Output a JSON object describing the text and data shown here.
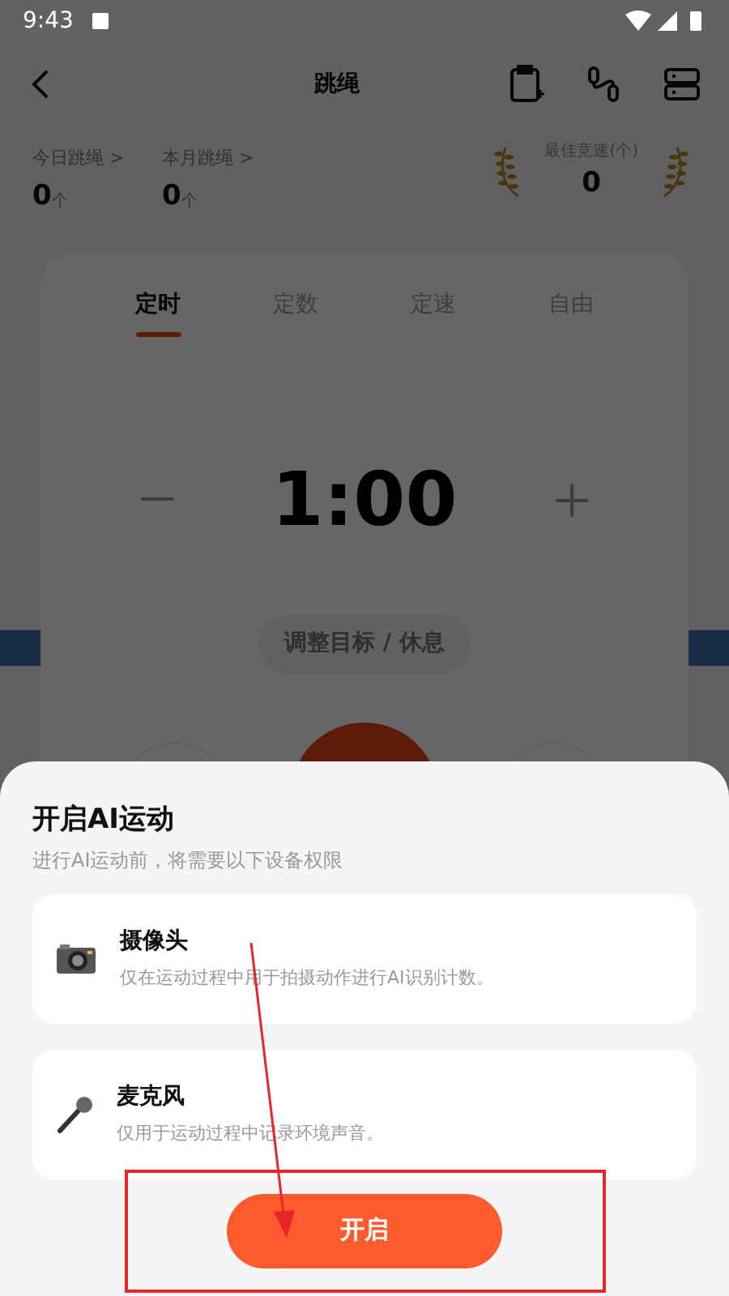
{
  "status_bar": {
    "time": "9:43"
  },
  "header": {
    "title": "跳绳"
  },
  "stats": [
    {
      "label": "今日跳绳 >",
      "value": "0",
      "unit": "个"
    },
    {
      "label": "本月跳绳 >",
      "value": "0",
      "unit": "个"
    }
  ],
  "best": {
    "label": "最佳竞速(个)",
    "value": "0"
  },
  "tabs": [
    {
      "label": "定时",
      "selected": true
    },
    {
      "label": "定数",
      "selected": false
    },
    {
      "label": "定速",
      "selected": false
    },
    {
      "label": "自由",
      "selected": false
    }
  ],
  "timer": {
    "value": "1:00"
  },
  "adjust_button": "调整目标 / 休息",
  "sheet": {
    "title": "开启AI运动",
    "subtitle": "进行AI运动前，将需要以下设备权限",
    "permissions": [
      {
        "kind": "camera",
        "name": "摄像头",
        "description": "仅在运动过程中用于拍摄动作进行AI识别计数。"
      },
      {
        "kind": "microphone",
        "name": "麦克风",
        "description": "仅用于运动过程中记录环境声音。"
      }
    ],
    "button": "开启"
  }
}
